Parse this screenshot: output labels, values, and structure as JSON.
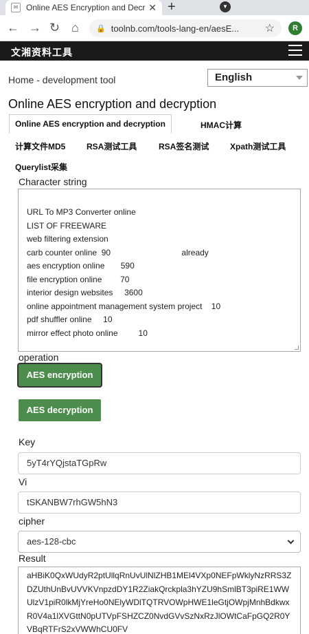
{
  "browser": {
    "tab_title": "Online AES Encryption and Decr",
    "url": "toolnb.com/tools-lang-en/aesE...",
    "avatar_letter": "R"
  },
  "site": {
    "logo": "文湘资料工具"
  },
  "breadcrumb": "Home - development tool",
  "language": "English",
  "page_title": "Online AES encryption and decryption",
  "tabs": [
    "Online AES encryption and decryption",
    "HMAC计算",
    "计算文件MD5",
    "RSA测试工具",
    "RSA签名测试",
    "Xpath测试工具",
    "Querylist采集"
  ],
  "form": {
    "string_label": "Character string",
    "string_lines": [
      "URL To MP3 Converter online",
      "LIST OF FREEWARE",
      "web filtering extension",
      "carb counter online  90                               already",
      "aes encryption online       590",
      "file encryption online        70",
      "interior design websites     3600",
      "online appointment management system project    10",
      "pdf shuffler online     10",
      "mirror effect photo online         10"
    ],
    "operation_label": "operation",
    "encrypt_button": "AES encryption",
    "decrypt_button": "AES decryption",
    "key_label": "Key",
    "key_value": "5yT4rYQjstaTGpRw",
    "vi_label": "Vi",
    "vi_value": "tSKANBW7rhGW5hN3",
    "cipher_label": "cipher",
    "cipher_value": "aes-128-cbc",
    "result_label": "Result",
    "result_value": "aHBiK0QxWUdyR2ptUllqRnUvUlNlZHB1MEl4VXp0NEFpWklyNzRRS3ZDZUthUnBvUVVKVnpzdDY1R2ZiakQrckpla3hYZU9hSmlBT3piRE1WWUlzV1piR0lkMjYreHo0NElyWDlTQTRVOWpHWE1leGtjOWpjMnhBdkwxR0V4a1lXVGttN0pUTVpFSHZCZ0NvdGVvSzNxRzJlOWtCaFpGQ2R0YVBqRTFrS2xVWWhCU0FV"
  }
}
